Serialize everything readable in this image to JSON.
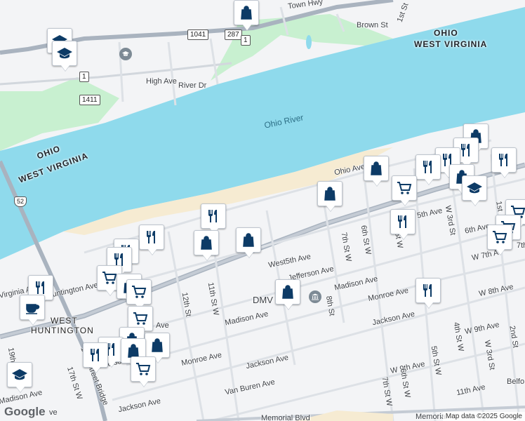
{
  "map": {
    "states": {
      "ohio_top": "OHIO",
      "wv_top": "WEST VIRGINIA",
      "ohio_left": "OHIO",
      "wv_left": "WEST VIRGINIA"
    },
    "river": "Ohio River",
    "place": {
      "line1": "WEST",
      "line2": "HUNTINGTON"
    },
    "poi": {
      "dmv": "DMV"
    },
    "shields": {
      "r1041": "1041",
      "r287": "287",
      "r1a": "1",
      "r1b": "1",
      "r1411": "1411",
      "us52": "52"
    },
    "streets": {
      "town_hwy": "Town Hwy",
      "first_st_top": "1st St",
      "brown_st": "Brown St",
      "high_ave": "High Ave",
      "river_dr": "River Dr",
      "ohio_ave": "Ohio Ave",
      "fifth_ave": "5th Ave",
      "west5th_ave": "West5th Ave",
      "w3rd_st": "W 3rd St",
      "sixth_ave": "6th Ave",
      "seventh_ave": "7th",
      "w7th_ave": "W 7th A",
      "first_st_right": "1st",
      "sixth_st_w": "6th St W",
      "seventh_st_w": "7th St W",
      "st_w": "St W",
      "jefferson_ave": "Jefferson Ave",
      "madison_ave_mid": "Madison Ave",
      "madison_ave_low": "Madison Ave",
      "eighth_st": "8th St",
      "monroe_ave_right": "Monroe Ave",
      "jackson_ave_right": "Jackson Ave",
      "w8th_ave": "W 8th Ave",
      "w9th_ave_right": "W 9th Ave",
      "fourth_st_w": "4th St W",
      "w3rd_st_low": "W 3rd St",
      "second_st": "2nd St",
      "fifth_st_w": "5th St W",
      "w9th_ave_low": "W 9th Ave",
      "sixth_st_w_low": "6th St W",
      "seventh_st_w_low": "7th St W",
      "eleventh_ave": "11th Ave",
      "belfo": "Belfo",
      "memorial_blvd": "Memorial Blvd",
      "memorial_low": "Memorial",
      "twelfth_st": "12th St",
      "eleventh_st_w": "11th St W",
      "monroe_ave_left": "Monroe Ave",
      "jackson_ave_mid": "Jackson Ave",
      "van_buren_ave": "Van Buren Ave",
      "jackson_ave_low": "Jackson Ave",
      "virginia_ave": "Virginia Ave",
      "huntington_ave": "Huntington Ave",
      "nineteenth": "19th",
      "madison_ave_left": "Madison Ave",
      "madison_left2": "Madison",
      "seventeenth_st": "17th St W",
      "seventeenth_bridge": "17th Street Bridge",
      "w_ave": "W",
      "ave_frag": "Ave",
      "ve_frag": "ve"
    },
    "icons": [
      "shopping-bag-icon",
      "graduation-cap-icon",
      "restaurant-icon",
      "shopping-cart-icon",
      "coffee-cup-icon",
      "bank-icon"
    ],
    "colors": {
      "water": "#8fdaec",
      "land": "#f3f4f6",
      "park": "#c8f0d0",
      "beach": "#f6ebd2",
      "road_main": "#a9b3bf",
      "pin_icon": "#0d3b66"
    }
  },
  "footer": {
    "logo": "Google",
    "attribution": "Map data ©2025 Google"
  }
}
